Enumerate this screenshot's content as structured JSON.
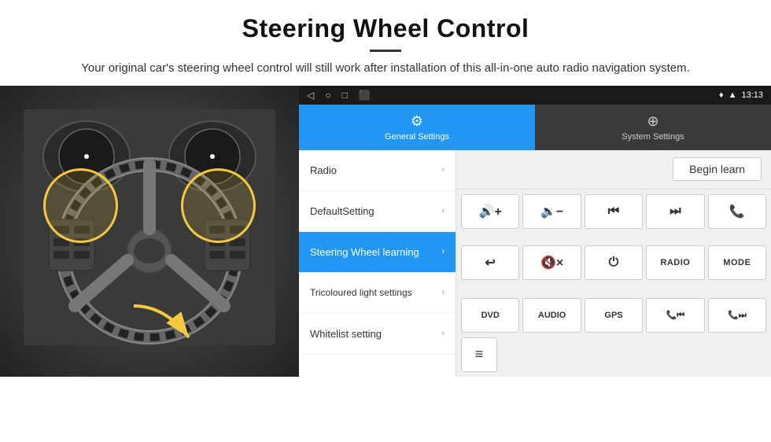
{
  "header": {
    "title": "Steering Wheel Control",
    "description": "Your original car's steering wheel control will still work after installation of this all-in-one auto radio navigation system."
  },
  "status_bar": {
    "time": "13:13",
    "nav_icons": [
      "◁",
      "○",
      "□",
      "⬛"
    ]
  },
  "tabs": {
    "general": {
      "label": "General Settings",
      "icon": "⚙"
    },
    "system": {
      "label": "System Settings",
      "icon": "🌐"
    }
  },
  "menu_items": [
    {
      "id": "radio",
      "label": "Radio",
      "active": false
    },
    {
      "id": "default",
      "label": "DefaultSetting",
      "active": false
    },
    {
      "id": "steering",
      "label": "Steering Wheel learning",
      "active": true
    },
    {
      "id": "tricolour",
      "label": "Tricoloured light settings",
      "active": false
    },
    {
      "id": "whitelist",
      "label": "Whitelist setting",
      "active": false
    }
  ],
  "right_panel": {
    "begin_learn_label": "Begin learn",
    "buttons_row1": [
      {
        "id": "vol-up",
        "label": "🔊+",
        "type": "icon"
      },
      {
        "id": "vol-down",
        "label": "🔉−",
        "type": "icon"
      },
      {
        "id": "prev",
        "label": "⏮",
        "type": "icon"
      },
      {
        "id": "next",
        "label": "⏭",
        "type": "icon"
      },
      {
        "id": "phone",
        "label": "📞",
        "type": "icon"
      }
    ],
    "buttons_row2": [
      {
        "id": "hang-up",
        "label": "↩",
        "type": "icon"
      },
      {
        "id": "mute",
        "label": "🔇×",
        "type": "icon"
      },
      {
        "id": "power",
        "label": "⏻",
        "type": "icon"
      },
      {
        "id": "radio-btn",
        "label": "RADIO",
        "type": "text"
      },
      {
        "id": "mode",
        "label": "MODE",
        "type": "text"
      }
    ],
    "buttons_row3": [
      {
        "id": "dvd",
        "label": "DVD",
        "type": "text"
      },
      {
        "id": "audio",
        "label": "AUDIO",
        "type": "text"
      },
      {
        "id": "gps",
        "label": "GPS",
        "type": "text"
      },
      {
        "id": "tel-prev",
        "label": "📞⏮",
        "type": "icon"
      },
      {
        "id": "tel-next",
        "label": "📞⏭",
        "type": "icon"
      }
    ],
    "buttons_row4": [
      {
        "id": "special",
        "label": "≡",
        "type": "icon"
      }
    ]
  }
}
